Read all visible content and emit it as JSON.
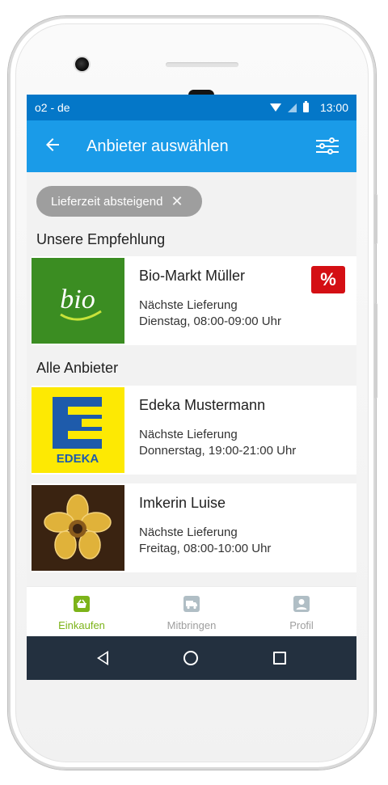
{
  "status_bar": {
    "carrier": "o2 - de",
    "time": "13:00",
    "icons": [
      "wifi-icon",
      "signal-icon",
      "battery-icon"
    ]
  },
  "app_bar": {
    "back_icon": "arrow-back-icon",
    "title": "Anbieter auswählen",
    "filter_icon": "tune-icon"
  },
  "filter_chip": {
    "label": "Lieferzeit absteigend",
    "close_icon": "close-icon"
  },
  "sections": {
    "recommended_title": "Unsere Empfehlung",
    "all_title": "Alle Anbieter"
  },
  "recommended": {
    "name": "Bio-Markt Müller",
    "next_label": "Nächste Lieferung",
    "slot": "Dienstag, 08:00-09:00 Uhr",
    "badge": "%",
    "logo_text": "bio"
  },
  "vendors": [
    {
      "name": "Edeka Mustermann",
      "next_label": "Nächste Lieferung",
      "slot": "Donnerstag, 19:00-21:00 Uhr",
      "logo_text": "EDEKA"
    },
    {
      "name": "Imkerin Luise",
      "next_label": "Nächste Lieferung",
      "slot": "Freitag, 08:00-10:00 Uhr",
      "logo_icon": "flower-bee-icon"
    }
  ],
  "bottom_nav": [
    {
      "label": "Einkaufen",
      "icon": "basket-icon",
      "active": true
    },
    {
      "label": "Mitbringen",
      "icon": "truck-icon",
      "active": false
    },
    {
      "label": "Profil",
      "icon": "person-icon",
      "active": false
    }
  ],
  "colors": {
    "status_bar": "#0477c8",
    "app_bar": "#1a9be8",
    "accent_active": "#7cb319",
    "badge": "#d40f14",
    "system_nav": "#23303f"
  }
}
